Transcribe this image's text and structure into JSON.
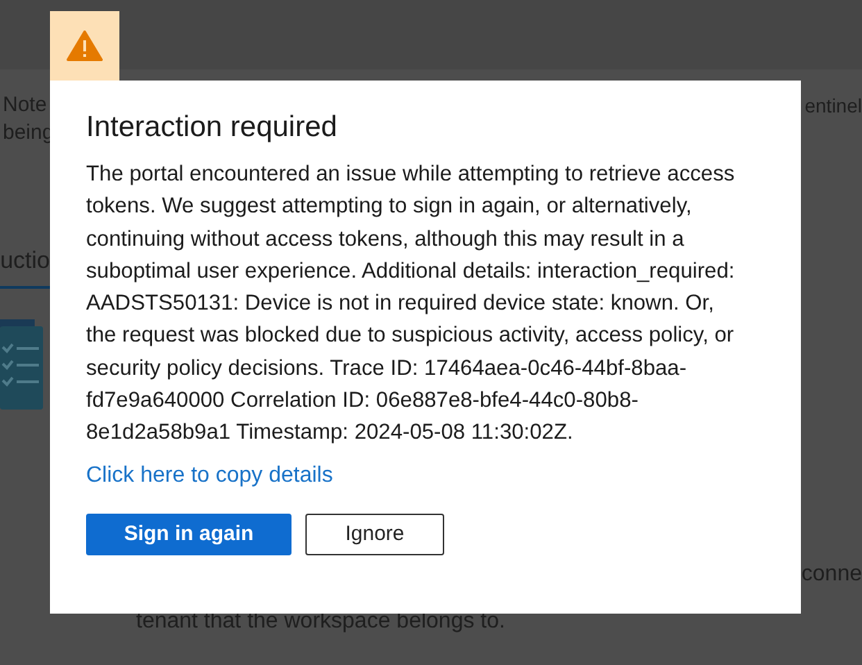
{
  "page": {
    "note_lines": [
      "Note",
      "being"
    ],
    "note_right": "entinel",
    "tab": {
      "label": "uctio",
      "selected": true
    },
    "side_text": "conne",
    "tenant_text": "tenant that the workspace belongs to."
  },
  "dialog": {
    "title": "Interaction required",
    "message": "The portal encountered an issue while attempting to retrieve access tokens. We suggest attempting to sign in again, or alternatively, continuing without access tokens, although this may result in a suboptimal user experience. Additional details: interaction_required: AADSTS50131: Device is not in required device state: known. Or, the request was blocked due to suspicious activity, access policy, or security policy decisions. Trace ID: 17464aea-0c46-44bf-8baa-fd7e9a640000 Correlation ID: 06e887e8-bfe4-44c0-80b8-8e1d2a58b9a1 Timestamp: 2024-05-08 11:30:02Z.",
    "link": "Click here to copy details",
    "buttons": [
      {
        "label": "Sign in again",
        "kind": "primary"
      },
      {
        "label": "Ignore",
        "kind": "secondary"
      }
    ]
  }
}
